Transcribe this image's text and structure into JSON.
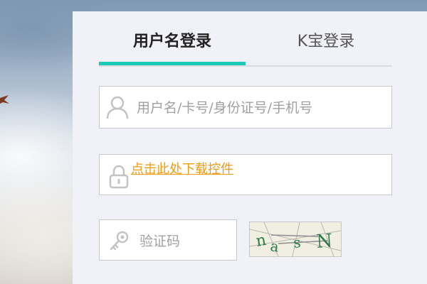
{
  "tabs": {
    "username_login": "用户名登录",
    "kbao_login": "K宝登录"
  },
  "form": {
    "username_placeholder": "用户名/卡号/身份证号/手机号",
    "download_control_link": "点击此处下载控件",
    "captcha_placeholder": "验证码"
  },
  "captcha": {
    "code": "nasN"
  },
  "icons": {
    "user": "user-icon",
    "lock": "lock-icon",
    "key": "key-icon"
  },
  "colors": {
    "accent": "#1ec8b6",
    "link": "#f09a10",
    "panel_bg": "#f1f2f8"
  }
}
